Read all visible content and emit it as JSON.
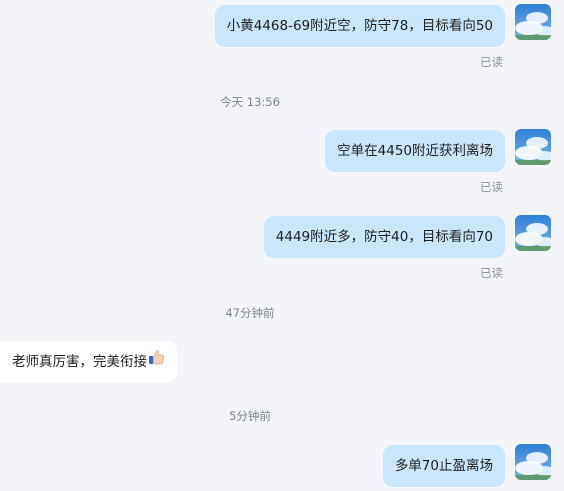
{
  "messages": [
    {
      "text": "小黄4468-69附近空，防守78，目标看向50",
      "status": "已读"
    },
    {
      "text": "空单在4450附近获利离场",
      "status": "已读"
    },
    {
      "text": "4449附近多，防守40，目标看向70",
      "status": "已读"
    },
    {
      "text": "老师真厉害，完美衔接"
    },
    {
      "text": "多单70止盈离场"
    }
  ],
  "timestamps": [
    "今天 13:56",
    "47分钟前",
    "5分钟前"
  ],
  "icons": {
    "avatar": "sky-cloud-avatar",
    "thumbs_up": "thumbs-up-emoji"
  },
  "colors": {
    "background": "#f4f5f9",
    "outgoing_bubble": "#c9e6fd",
    "incoming_bubble": "#ffffff"
  }
}
